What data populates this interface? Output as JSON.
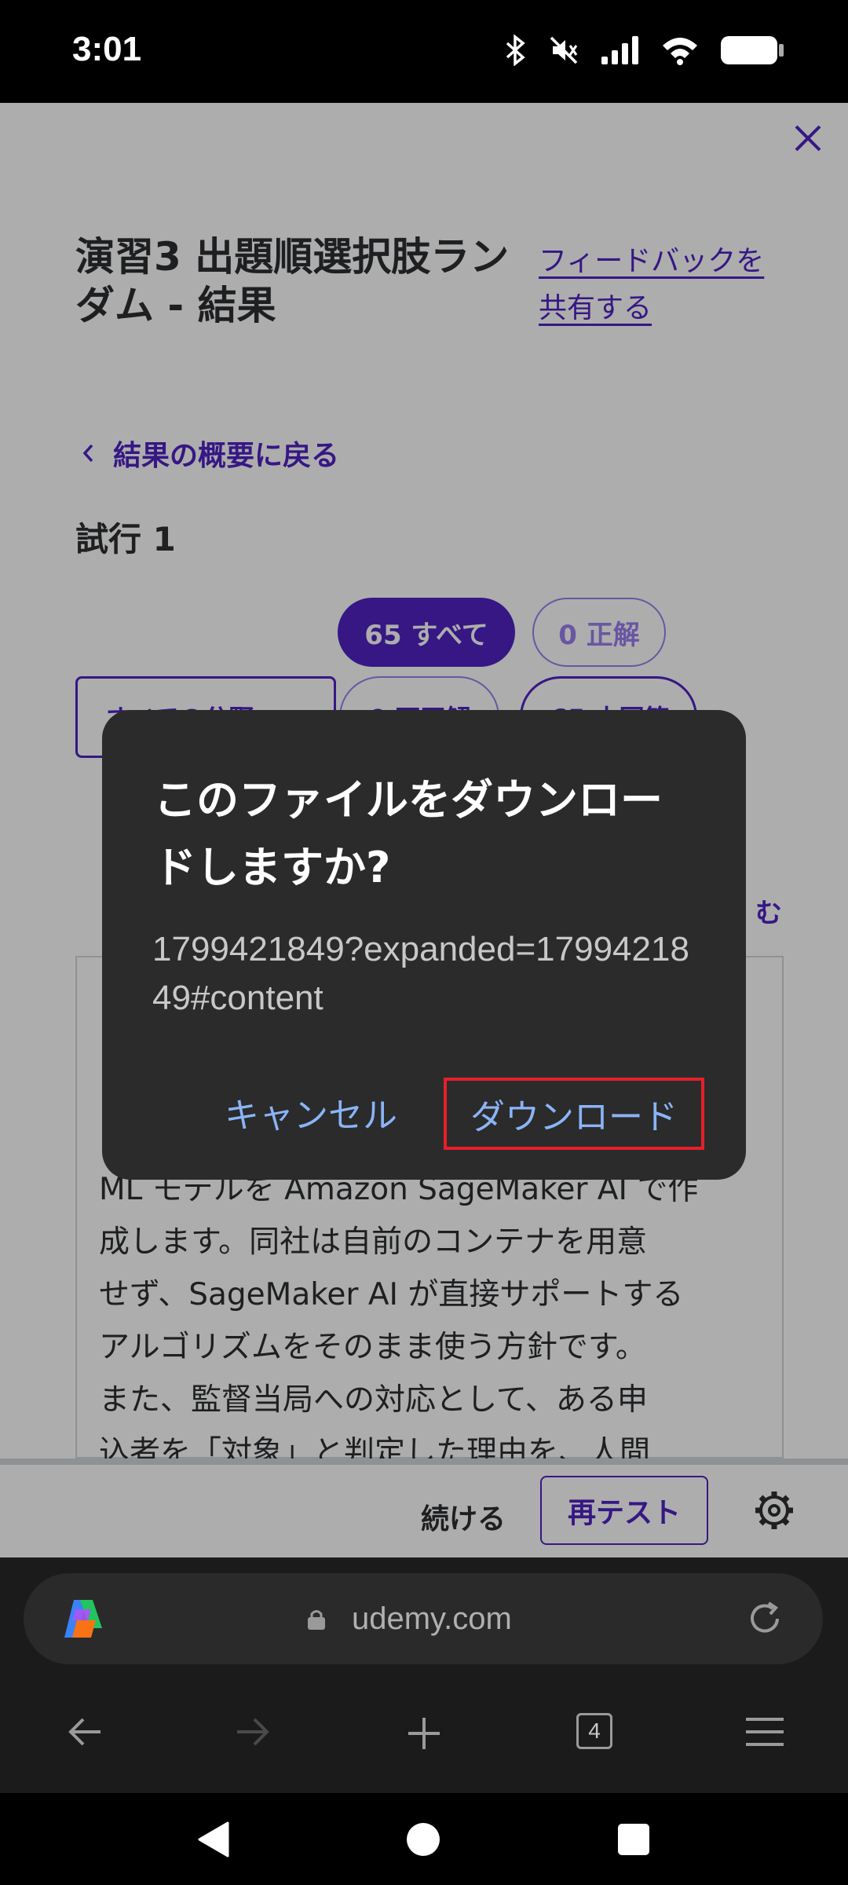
{
  "status_bar": {
    "time": "3:01"
  },
  "page": {
    "title": "演習3 出題順選択肢ランダム - 結果",
    "feedback_link": "フィードバックを共有する",
    "back_link": "結果の概要に戻る",
    "attempt": "試行 1",
    "pills": {
      "all": "65 すべて",
      "correct": "0 正解"
    },
    "filters": [
      "すべての分野",
      "0 不正解",
      "65 未回答"
    ],
    "expand_link": "む",
    "question_lines": [
      "ML モデルを Amazon SageMaker AI で作",
      "成します。同社は自前のコンテナを用意",
      "せず、SageMaker AI が直接サポートする",
      "アルゴリズムをそのまま使う方針です。",
      "また、監督当局への対応として、ある申",
      "込者を「対象」と判定した理由を、人間"
    ],
    "action_bar": {
      "continue": "続ける",
      "retest": "再テスト"
    }
  },
  "dialog": {
    "title": "このファイルをダウンロードしますか?",
    "filename": "1799421849?expanded=1799421849#content",
    "cancel": "キャンセル",
    "download": "ダウンロード"
  },
  "browser": {
    "url": "udemy.com",
    "tab_count": "4"
  },
  "colors": {
    "accent": "#5022c3",
    "dialog_bg": "#2b2b2b",
    "dialog_button": "#8ab4f8",
    "highlight": "#e5202a"
  }
}
